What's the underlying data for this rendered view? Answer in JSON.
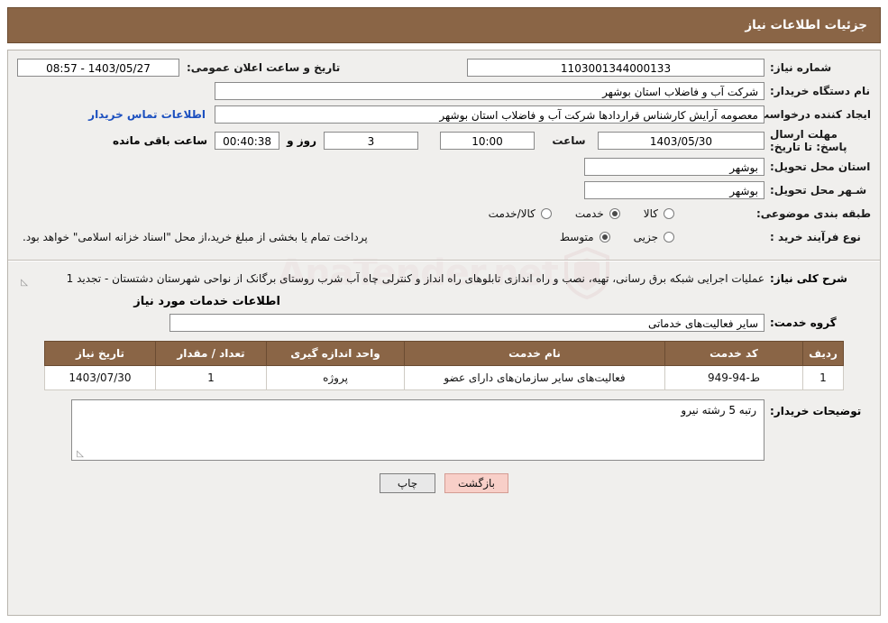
{
  "header": {
    "title": "جزئیات اطلاعات نیاز"
  },
  "form": {
    "need_number_label": "شماره نیاز:",
    "need_number_value": "1103001344000133",
    "announce_datetime_label": "تاریخ و ساعت اعلان عمومی:",
    "announce_datetime_value": "1403/05/27 - 08:57",
    "buyer_org_label": "نام دستگاه خریدار:",
    "buyer_org_value": "شرکت آب و فاضلاب استان بوشهر",
    "requester_label": "ایجاد کننده درخواست:",
    "requester_value": "معصومه آرایش کارشناس قراردادها شرکت آب و فاضلاب استان بوشهر",
    "contact_link": "اطلاعات تماس خریدار",
    "deadline_label": "مهلت ارسال پاسخ: تا تاریخ:",
    "deadline_date": "1403/05/30",
    "hour_label": "ساعت",
    "hour_value": "10:00",
    "days_value": "3",
    "days_label": "روز و",
    "remaining_value": "00:40:38",
    "remaining_label": "ساعت باقی مانده",
    "delivery_province_label": "استان محل تحویل:",
    "delivery_province_value": "بوشهر",
    "delivery_city_label": "شـهر محل تحویل:",
    "delivery_city_value": "بوشهر",
    "category_label": "طبقه بندی موضوعی:",
    "category_options": [
      {
        "label": "کالا",
        "checked": false
      },
      {
        "label": "خدمت",
        "checked": true
      },
      {
        "label": "کالا/خدمت",
        "checked": false
      }
    ],
    "purchase_type_label": "نوع فرآیند خرید :",
    "purchase_type_options": [
      {
        "label": "جزیی",
        "checked": false
      },
      {
        "label": "متوسط",
        "checked": true
      }
    ],
    "purchase_note": "پرداخت تمام یا بخشی از مبلغ خرید،از محل \"اسناد خزانه اسلامی\" خواهد بود."
  },
  "description": {
    "label": "شرح کلی نیاز:",
    "text": "عملیات اجرایی شبکه برق رسانی، تهیه، نصب و راه اندازی تابلوهای راه انداز و کنترلی چاه آب شرب روستای برگانک از نواحی شهرستان دشتستان - تجدید 1"
  },
  "services": {
    "section_title": "اطلاعات خدمات مورد نیاز",
    "group_label": "گروه خدمت:",
    "group_value": "سایر فعالیت‌های خدماتی",
    "columns": [
      "ردیف",
      "کد خدمت",
      "نام خدمت",
      "واحد اندازه گیری",
      "تعداد / مقدار",
      "تاریخ نیاز"
    ],
    "rows": [
      {
        "index": "1",
        "code": "ط-94-949",
        "name": "فعالیت‌های سایر سازمان‌های دارای عضو",
        "unit": "پروژه",
        "quantity": "1",
        "date": "1403/07/30"
      }
    ]
  },
  "buyer_notes": {
    "label": "توضیحات خریدار:",
    "value": "رتبه 5 رشته نیرو"
  },
  "buttons": {
    "print": "چاپ",
    "back": "بازگشت"
  },
  "watermark": {
    "text": "AnaTender.net"
  },
  "colors": {
    "header_bg": "#8a6546",
    "panel_bg": "#f0efed",
    "link": "#1b4fbf",
    "back_btn": "#f8cfc8"
  }
}
